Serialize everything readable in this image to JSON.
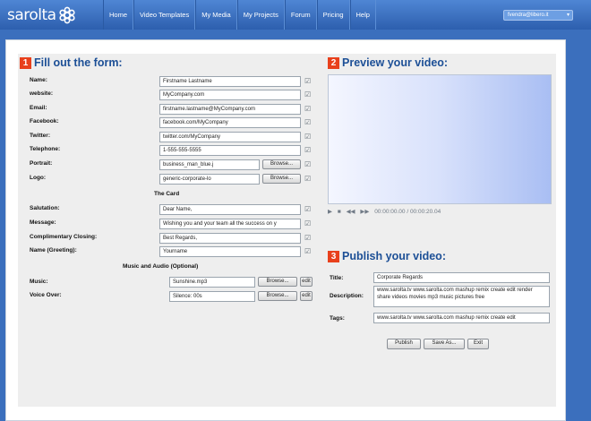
{
  "brand": {
    "logo_text": "sarolta"
  },
  "nav": [
    "Home",
    "Video Templates",
    "My Media",
    "My Projects",
    "Forum",
    "Pricing",
    "Help"
  ],
  "user_menu": "fvendra@libero.it",
  "step1": {
    "num": "1",
    "title": "Fill out the form:"
  },
  "step2": {
    "num": "2",
    "title": "Preview your video:"
  },
  "step3": {
    "num": "3",
    "title": "Publish your video:"
  },
  "form": {
    "name": {
      "label": "Name:",
      "value": "Firstname Lastname"
    },
    "website": {
      "label": "website:",
      "value": "MyCompany.com"
    },
    "email": {
      "label": "Email:",
      "value": "firstname.lastname@MyCompany.com"
    },
    "facebook": {
      "label": "Facebook:",
      "value": "facebook.com/MyCompany"
    },
    "twitter": {
      "label": "Twitter:",
      "value": "twitter.com/MyCompany"
    },
    "telephone": {
      "label": "Telephone:",
      "value": "1-555-555-5555"
    },
    "portrait": {
      "label": "Portrait:",
      "value": "business_man_blue.j",
      "browse": "Browse..."
    },
    "logo": {
      "label": "Logo:",
      "value": "generic-corporate-lo",
      "browse": "Browse..."
    },
    "card_heading": "The Card",
    "salutation": {
      "label": "Salutation:",
      "value": "Dear Name,"
    },
    "message": {
      "label": "Message:",
      "value": "Wishing you and your team all the success on y"
    },
    "closing": {
      "label": "Complimentary Closing:",
      "value": "Best Regards,"
    },
    "name_greeting": {
      "label": "Name (Greeting):",
      "value": "Yourname"
    },
    "music_heading": "Music and Audio (Optional)",
    "music": {
      "label": "Music:",
      "value": "Sunshine.mp3",
      "browse": "Browse...",
      "extra": "edit"
    },
    "voice": {
      "label": "Voice Over:",
      "value": "Silence: 00s",
      "browse": "Browse...",
      "extra": "edit"
    }
  },
  "player": {
    "time": "00:00:00.00 / 00:00:20.04"
  },
  "publish": {
    "title": {
      "label": "Title:",
      "value": "Corporate Regards"
    },
    "description": {
      "label": "Description:",
      "value": "www.sarolta.tv www.sarolta.com mashup remix create edit render share videos movies mp3 music pictures free"
    },
    "tags": {
      "label": "Tags:",
      "value": "www.sarolta.tv www.sarolta.com mashup remix create edit"
    },
    "buttons": {
      "publish": "Publish",
      "save_as": "Save As...",
      "exit": "Exit"
    }
  }
}
